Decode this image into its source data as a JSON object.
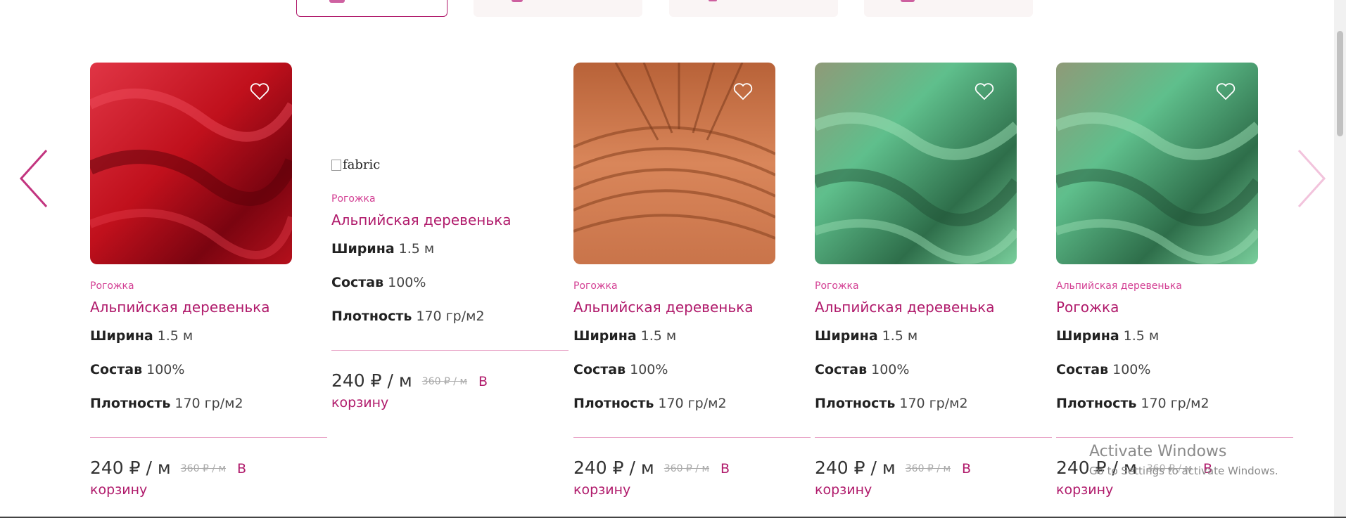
{
  "tabs": [
    {
      "active": true
    },
    {
      "active": false
    },
    {
      "active": false
    },
    {
      "active": false
    }
  ],
  "products": [
    {
      "image": "red-fabric",
      "image_colors": [
        "#c0101c",
        "#7a0410",
        "#e03545"
      ],
      "category": "Рогожка",
      "name": "Альпийская деревенька",
      "width_label": "Ширина",
      "width_value": "1.5 м",
      "composition_label": "Состав",
      "composition_value": "100%",
      "density_label": "Плотность",
      "density_value": "170 гр/м2",
      "price": "240 ₽ / м",
      "old_price": "360 ₽ / м",
      "cart_label_1": "В",
      "cart_label_2": "корзину"
    },
    {
      "image": "broken",
      "image_alt": "fabric",
      "category": "Рогожка",
      "name": "Альпийская деревенька",
      "width_label": "Ширина",
      "width_value": "1.5 м",
      "composition_label": "Состав",
      "composition_value": "100%",
      "density_label": "Плотность",
      "density_value": "170 гр/м2",
      "price": "240 ₽ / м",
      "old_price": "360 ₽ / м",
      "cart_label_1": "В",
      "cart_label_2": "корзину"
    },
    {
      "image": "orange-fabric",
      "image_colors": [
        "#c9744a",
        "#8b4522",
        "#e89a6c"
      ],
      "category": "Рогожка",
      "name": "Альпийская деревенька",
      "width_label": "Ширина",
      "width_value": "1.5 м",
      "composition_label": "Состав",
      "composition_value": "100%",
      "density_label": "Плотность",
      "density_value": "170 гр/м2",
      "price": "240 ₽ / м",
      "old_price": "360 ₽ / м",
      "cart_label_1": "В",
      "cart_label_2": "корзину"
    },
    {
      "image": "green-fabric",
      "image_colors": [
        "#5fbf8c",
        "#2e6e4a",
        "#9de0b6"
      ],
      "category": "Рогожка",
      "name": "Альпийская деревенька",
      "width_label": "Ширина",
      "width_value": "1.5 м",
      "composition_label": "Состав",
      "composition_value": "100%",
      "density_label": "Плотность",
      "density_value": "170 гр/м2",
      "price": "240 ₽ / м",
      "old_price": "360 ₽ / м",
      "cart_label_1": "В",
      "cart_label_2": "корзину"
    },
    {
      "image": "green-fabric",
      "image_colors": [
        "#5fbf8c",
        "#2e6e4a",
        "#9de0b6"
      ],
      "category": "Альпийская деревенька",
      "name": "Рогожка",
      "width_label": "Ширина",
      "width_value": "1.5 м",
      "composition_label": "Состав",
      "composition_value": "100%",
      "density_label": "Плотность",
      "density_value": "170 гр/м2",
      "price": "240 ₽ / м",
      "old_price": "360 ₽ / м",
      "cart_label_1": "В",
      "cart_label_2": "корзину"
    }
  ],
  "watermark": {
    "title": "Activate Windows",
    "subtitle": "Go to Settings to activate Windows."
  },
  "colors": {
    "accent": "#b01a6b",
    "category": "#d33f93",
    "divider": "#e9a6c8",
    "arrow_active": "#c2347f",
    "arrow_disabled": "#f2c3dc"
  },
  "icons": {
    "prev": "chevron-left-icon",
    "next": "chevron-right-icon",
    "favorite": "heart-outline-icon"
  }
}
